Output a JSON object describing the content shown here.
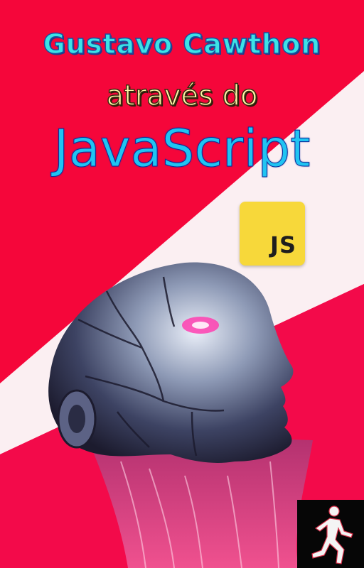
{
  "cover": {
    "author": "Gustavo Cawthon",
    "subtitle": "através do",
    "title": "JavaScript",
    "badge_text": "JS"
  },
  "colors": {
    "background": "#f5063a",
    "stripe": "#ffffff",
    "author_text": "#3ce3e6",
    "subtitle_text": "#fff6a8",
    "title_text": "#20c4f2",
    "badge": "#f7d83a"
  },
  "icons": {
    "badge": "javascript-logo-icon",
    "publisher": "running-figure-icon"
  }
}
